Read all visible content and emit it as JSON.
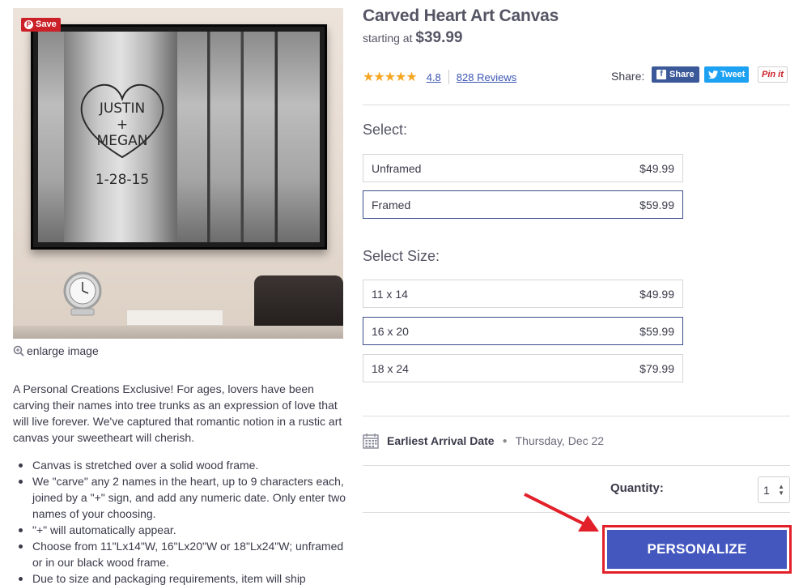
{
  "image": {
    "carving_names": [
      "JUSTIN",
      "+",
      "MEGAN"
    ],
    "carving_date": "1-28-15",
    "save_label": "Save",
    "enlarge_label": "enlarge image"
  },
  "product": {
    "title": "Carved Heart Art Canvas",
    "starting_at_label": "starting at",
    "starting_price": "$39.99",
    "rating": "4.8",
    "reviews": "828 Reviews"
  },
  "share": {
    "label": "Share:",
    "facebook": "Share",
    "twitter": "Tweet",
    "pinterest": "Pin it"
  },
  "select": {
    "label": "Select:",
    "options": [
      {
        "name": "Unframed",
        "price": "$49.99"
      },
      {
        "name": "Framed",
        "price": "$59.99"
      }
    ],
    "selected": "Framed"
  },
  "size": {
    "label": "Select Size:",
    "options": [
      {
        "name": "11 x 14",
        "price": "$49.99"
      },
      {
        "name": "16 x 20",
        "price": "$59.99"
      },
      {
        "name": "18 x 24",
        "price": "$79.99"
      }
    ],
    "selected": "16 x 20"
  },
  "arrival": {
    "label": "Earliest Arrival Date",
    "date": "Thursday, Dec 22"
  },
  "quantity": {
    "label": "Quantity:",
    "value": "1"
  },
  "cta": {
    "label": "PERSONALIZE"
  },
  "description": {
    "intro": "A Personal Creations Exclusive! For ages, lovers have been carving their names into tree trunks as an expression of love that will live forever. We've captured that romantic notion in a rustic art canvas your sweetheart will cherish.",
    "bullets": [
      "Canvas is stretched over a solid wood frame.",
      "We \"carve\" any 2 names in the heart, up to 9 characters each, joined by a \"+\" sign, and add any numeric date. Only enter two names of your choosing.",
      "\"+\" will automatically appear.",
      "Choose from 11\"Lx14\"W, 16\"Lx20\"W or 18\"Lx24\"W; unframed or in our black wood frame.",
      "Due to size and packaging requirements, item will ship"
    ]
  },
  "colors": {
    "accent": "#4457bf",
    "highlight": "#e2202a",
    "star": "#f5a623",
    "link": "#3b56b3"
  }
}
